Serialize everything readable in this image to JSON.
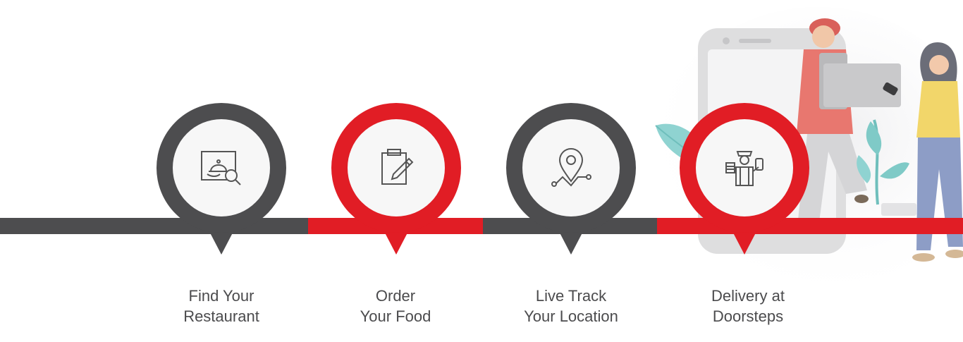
{
  "colors": {
    "dark": "#4d4d4f",
    "red": "#e11d25",
    "inner": "#f7f7f7",
    "text": "#4b4b4d"
  },
  "steps": [
    {
      "line1": "Find Your",
      "line2": "Restaurant",
      "icon": "restaurant-search-icon",
      "color": "dark"
    },
    {
      "line1": "Order",
      "line2": "Your Food",
      "icon": "order-clipboard-icon",
      "color": "red"
    },
    {
      "line1": "Live Track",
      "line2": "Your Location",
      "icon": "location-pin-icon",
      "color": "dark"
    },
    {
      "line1": "Delivery at",
      "line2": "Doorsteps",
      "icon": "delivery-person-icon",
      "color": "red"
    }
  ],
  "illustration": "delivery-illustration"
}
